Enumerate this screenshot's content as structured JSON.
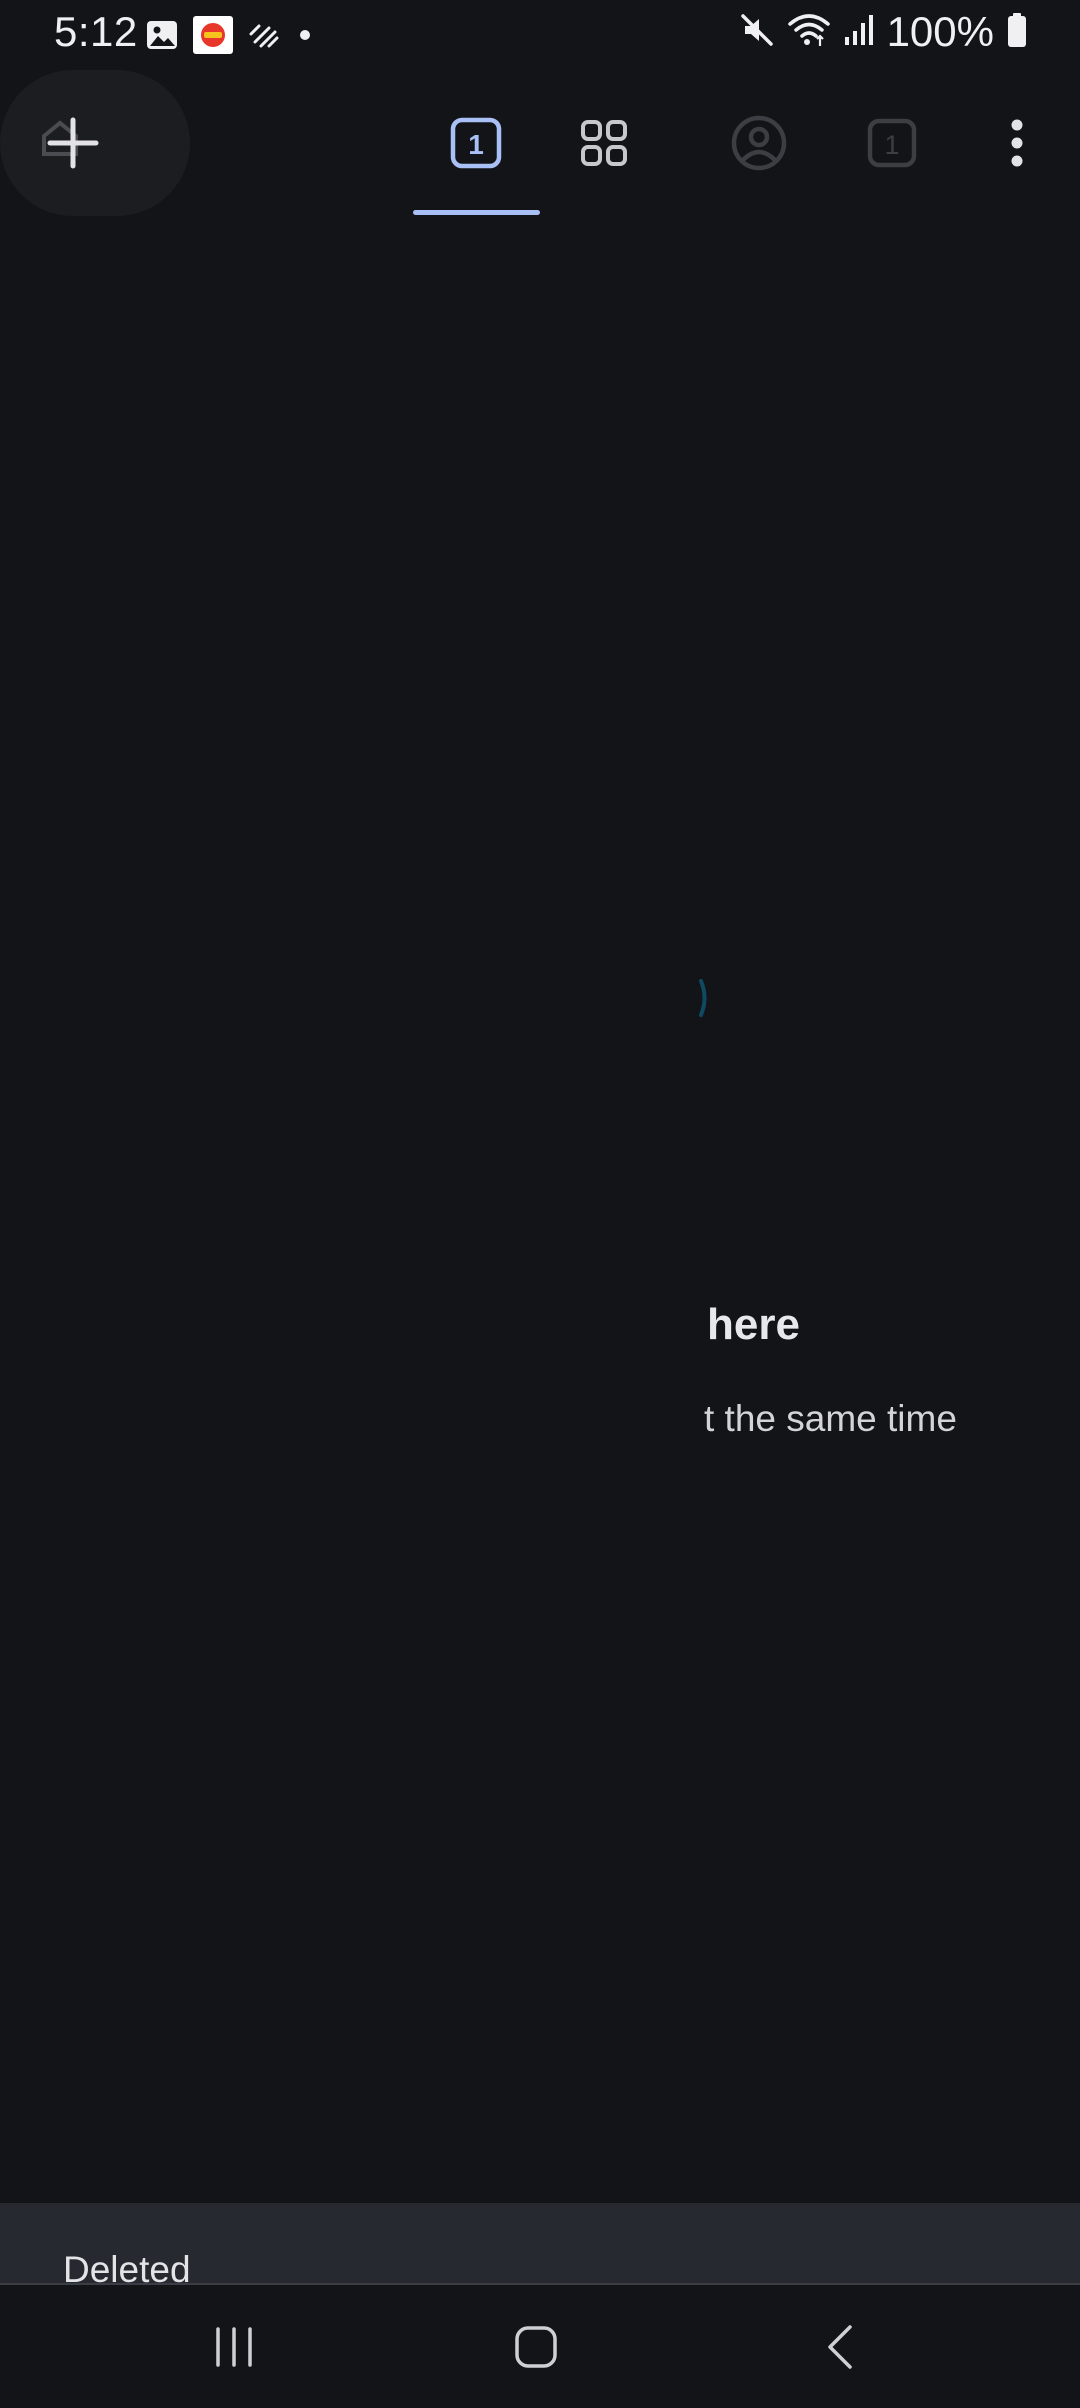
{
  "status_bar": {
    "time": "5:12",
    "battery": "100%",
    "left_icons": [
      "gallery-icon",
      "app-badge-icon",
      "data-saver-icon",
      "dot-icon"
    ],
    "right_icons": [
      "mute-icon",
      "wifi-icon",
      "signal-icon",
      "battery-icon"
    ]
  },
  "toolbar": {
    "new_tab_icon": "plus-icon",
    "tabs": [
      {
        "icon": "tab-count-icon",
        "count": "1",
        "selected": true
      },
      {
        "icon": "tab-groups-icon",
        "selected": false
      },
      {
        "icon": "incognito-account-icon",
        "selected": false
      },
      {
        "icon": "tab-count-icon",
        "count": "1",
        "selected": false
      }
    ],
    "menu_icon": "more-vert-icon"
  },
  "empty_state": {
    "title": "here",
    "subtitle": "t the same time"
  },
  "snackbar": {
    "message": "Deleted"
  },
  "nav_bar": {
    "items": [
      "recent-apps-icon",
      "home-icon",
      "back-icon"
    ]
  },
  "colors": {
    "background": "#131417",
    "accent": "#a8c0f5",
    "snackbar": "#262930"
  }
}
